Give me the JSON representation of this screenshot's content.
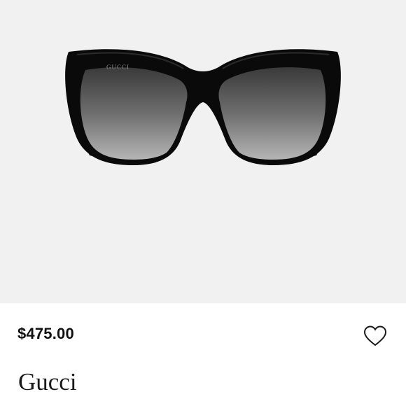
{
  "product": {
    "price": "$475.00",
    "brand": "Gucci",
    "logo_text": "GUCCI"
  },
  "icons": {
    "favorite": "heart-outline-icon"
  },
  "colors": {
    "image_background": "#f1f1f1",
    "frame": "#0a0a0a",
    "text": "#111111"
  }
}
